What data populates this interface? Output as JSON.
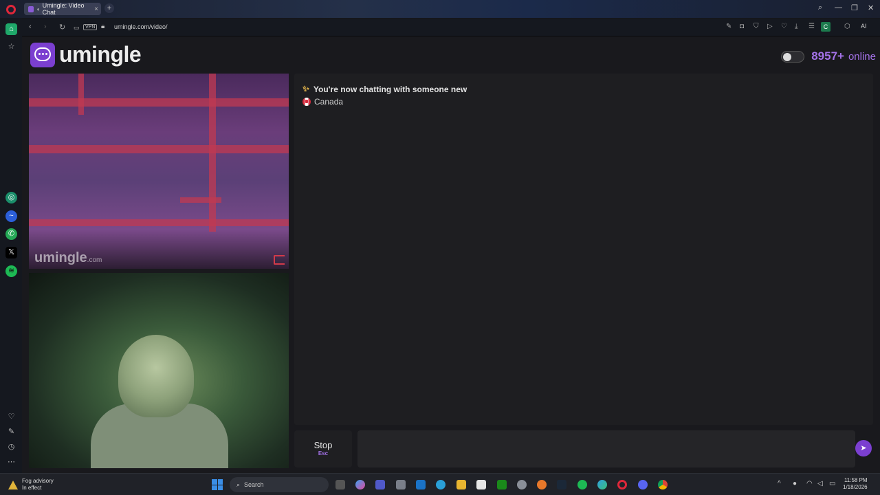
{
  "browser": {
    "tab_title": "Umingle: Video Chat",
    "url": "umingle.com/video/",
    "vpn_label": "VPN",
    "ai_label": "AI",
    "ext_c_label": "C"
  },
  "header": {
    "logo_text": "umingle",
    "online_count": "8957+",
    "online_label": "online"
  },
  "video": {
    "watermark": "umingle",
    "watermark_suffix": ".com"
  },
  "chat": {
    "status_message": "You're now chatting with someone new",
    "partner_country": "Canada",
    "stop_label": "Stop",
    "stop_shortcut": "Esc",
    "message_placeholder": ""
  },
  "taskbar": {
    "weather_title": "Fog advisory",
    "weather_subtitle": "In effect",
    "search_label": "Search",
    "time": "11:58 PM",
    "date": "1/18/2026"
  },
  "colors": {
    "brand_purple": "#7b3fd0",
    "online_purple": "#a472e8",
    "opera_red": "#e0273a"
  },
  "icons": {
    "sidebar": [
      "home-icon",
      "star-icon",
      "chatgpt-icon",
      "messenger-icon",
      "whatsapp-icon",
      "x-icon",
      "spotify-icon",
      "heart-icon",
      "edit-icon",
      "history-icon",
      "more-icon"
    ],
    "taskbar": [
      "windows-start-icon",
      "search-icon",
      "task-view-icon",
      "copilot-icon",
      "teams-icon",
      "store-icon",
      "outlook-icon",
      "telegram-icon",
      "file-explorer-icon",
      "notepad-icon",
      "xbox-icon",
      "settings-icon",
      "blender-icon",
      "steam-icon",
      "spotify-icon",
      "edge-icon",
      "opera-icon",
      "discord-icon",
      "chrome-icon"
    ]
  }
}
